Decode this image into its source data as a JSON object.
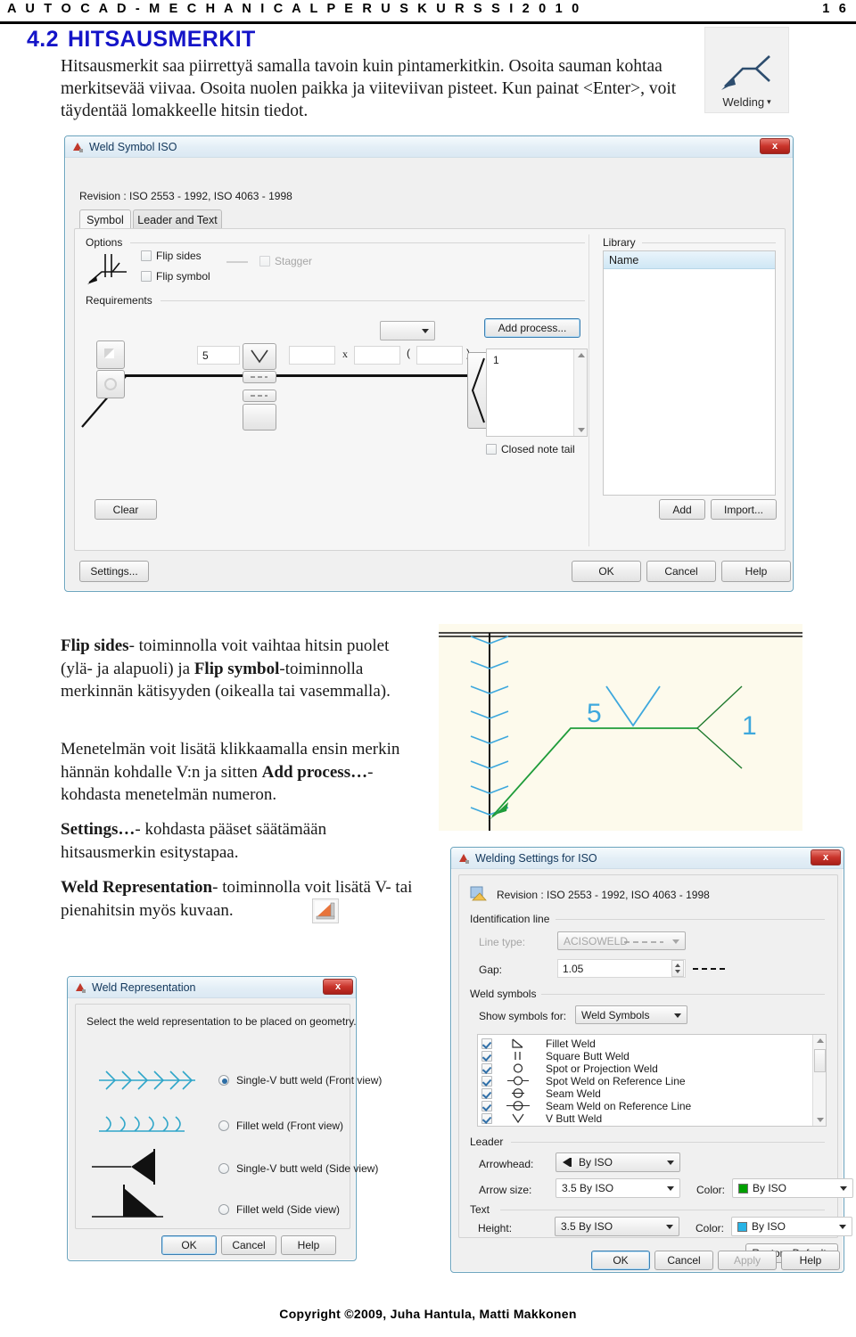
{
  "header": {
    "title": "A U T O C A D - M E C H A N I C A L   P E R U S K U R S S I   2 0 1 0",
    "page_number": "1 6"
  },
  "section": {
    "number": "4.2",
    "title": "HITSAUSMERKIT",
    "intro": "Hitsausmerkit saa piirrettyä samalla tavoin kuin pintamerkitkin. Osoita sauman kohtaa merkitsevää viivaa. Osoita nuolen paikka ja viiteviivan pisteet. Kun painat <Enter>, voit täydentää lomakkeelle hitsin tiedot."
  },
  "welding_toolbar": {
    "label": "Welding",
    "caret": "▾",
    "icon": "welding-leader-icon"
  },
  "weld_symbol_dialog": {
    "title": "Weld Symbol ISO",
    "close_label": "x",
    "revision": "Revision : ISO 2553 - 1992, ISO 4063 - 1998",
    "tabs": [
      {
        "label": "Symbol",
        "active": true
      },
      {
        "label": "Leader and Text",
        "active": false
      }
    ],
    "groups": {
      "options": "Options",
      "requirements": "Requirements",
      "library": "Library"
    },
    "checkboxes": [
      {
        "label": "Flip sides",
        "checked": false,
        "enabled": true
      },
      {
        "label": "Flip symbol",
        "checked": false,
        "enabled": true
      },
      {
        "label": "Stagger",
        "checked": false,
        "enabled": false
      },
      {
        "label": "Closed note tail",
        "checked": false,
        "enabled": true
      }
    ],
    "fields": {
      "size": "5",
      "length": "",
      "multiplier": "x",
      "pitch": "",
      "paren_open": "(",
      "paren_value": "",
      "paren_close": ")",
      "process_number": "1"
    },
    "library_header": "Name",
    "library_items": [],
    "buttons": {
      "add_process": "Add process...",
      "clear": "Clear",
      "add": "Add",
      "import": "Import...",
      "settings": "Settings...",
      "ok": "OK",
      "cancel": "Cancel",
      "help": "Help"
    }
  },
  "explanation": {
    "p1_bold1": "Flip sides",
    "p1_a": "- toiminnolla voit vaihtaa hitsin puolet (ylä- ja alapuoli) ja ",
    "p1_bold2": "Flip symbol",
    "p1_b": "-toiminnolla merkinnän kätisyyden (oikealla tai vasemmalla).",
    "p2_a": "Menetelmän voit lisätä klikkaamalla ensin merkin hännän kohdalle V:n ja sitten ",
    "p2_bold": "Add process…",
    "p2_b": "- kohdasta menetelmän numeron.",
    "p3_bold": "Settings…",
    "p3_a": "- kohdasta pääset säätämään hitsausmerkin esitystapaa.",
    "p4_bold": "Weld Representation",
    "p4_a": "- toiminnolla voit lisätä V- tai pienahitsin myös kuvaan."
  },
  "cad_illustration": {
    "size_label": "5",
    "process_label": "1",
    "symbol": "V butt weld",
    "colors": {
      "leader": "#1f9c3a",
      "symbol": "#2ba6dd",
      "seam": "#3ea8dd",
      "edge": "#1a1a1a",
      "background": "#fdfaec"
    }
  },
  "weld_representation_dialog": {
    "title": "Weld Representation",
    "close_label": "x",
    "prompt": "Select the weld representation to be placed on geometry.",
    "options": [
      {
        "label": "Single-V butt weld (Front view)",
        "selected": true
      },
      {
        "label": "Fillet weld (Front view)",
        "selected": false
      },
      {
        "label": "Single-V butt weld (Side view)",
        "selected": false
      },
      {
        "label": "Fillet weld (Side view)",
        "selected": false
      }
    ],
    "buttons": {
      "ok": "OK",
      "cancel": "Cancel",
      "help": "Help"
    }
  },
  "welding_settings_dialog": {
    "title": "Welding Settings for ISO",
    "close_label": "x",
    "revision": "Revision : ISO 2553 - 1992, ISO 4063 - 1998",
    "groups": {
      "identification_line": "Identification line",
      "weld_symbols": "Weld symbols",
      "leader": "Leader",
      "text": "Text"
    },
    "fields": {
      "line_type_label": "Line type:",
      "line_type_value": "ACISOWELD",
      "gap_label": "Gap:",
      "gap_value": "1.05",
      "show_symbols_label": "Show symbols for:",
      "show_symbols_value": "Weld Symbols",
      "arrowhead_label": "Arrowhead:",
      "arrowhead_value": "By ISO",
      "arrow_size_label": "Arrow size:",
      "arrow_size_value": "3.5  By ISO",
      "arrow_color_label": "Color:",
      "arrow_color_value": "By ISO",
      "arrow_color_hex": "#00a000",
      "text_height_label": "Height:",
      "text_height_value": "3.5  By ISO",
      "text_color_label": "Color:",
      "text_color_value": "By ISO",
      "text_color_hex": "#28b4e6"
    },
    "symbol_list": [
      {
        "label": "Fillet Weld",
        "checked": true,
        "glyph": "fillet-weld-icon"
      },
      {
        "label": "Square Butt Weld",
        "checked": true,
        "glyph": "square-butt-weld-icon"
      },
      {
        "label": "Spot or Projection Weld",
        "checked": true,
        "glyph": "spot-weld-icon"
      },
      {
        "label": "Spot Weld on Reference Line",
        "checked": true,
        "glyph": "spot-weld-ref-line-icon"
      },
      {
        "label": "Seam Weld",
        "checked": true,
        "glyph": "seam-weld-icon"
      },
      {
        "label": "Seam Weld on Reference Line",
        "checked": true,
        "glyph": "seam-weld-ref-line-icon"
      },
      {
        "label": "V Butt Weld",
        "checked": true,
        "glyph": "v-butt-weld-icon"
      }
    ],
    "buttons": {
      "restore_defaults": "Restore Defaults",
      "ok": "OK",
      "cancel": "Cancel",
      "apply": "Apply",
      "help": "Help"
    }
  },
  "footer": "Copyright  ©2009, Juha Hantula, Matti Makkonen"
}
